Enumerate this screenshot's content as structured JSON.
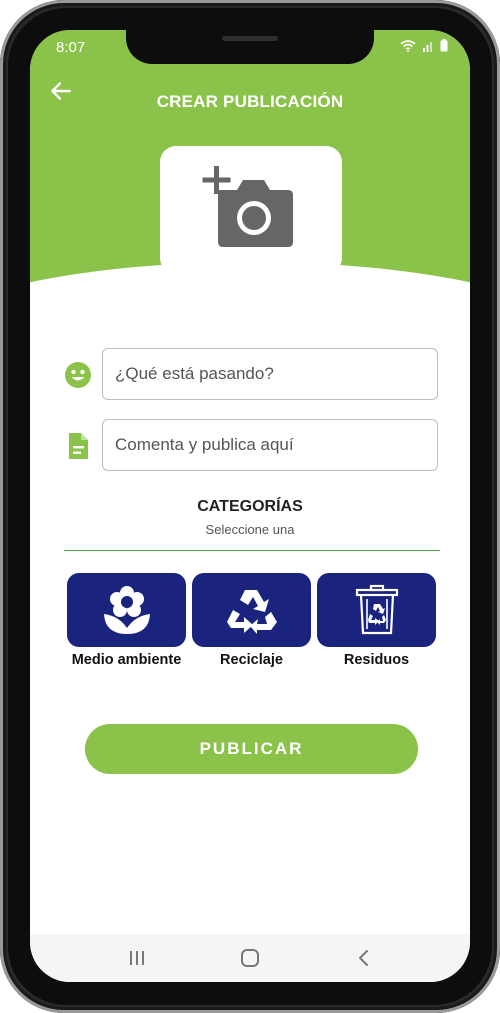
{
  "status_bar": {
    "time": "8:07",
    "wifi_icon": "wifi-icon",
    "signal_icon": "signal-icon",
    "battery_icon": "battery-icon"
  },
  "header": {
    "title": "CREAR PUBLICACIÓN",
    "back_icon": "arrow-left-icon",
    "photo_icon": "add-photo-icon"
  },
  "colors": {
    "primary_green": "#8bc34a",
    "category_blue": "#1a237e",
    "divider_green": "#43a047"
  },
  "form": {
    "title_field": {
      "placeholder": "¿Qué está pasando?",
      "value": "",
      "icon": "smiley-icon"
    },
    "comment_field": {
      "placeholder": "Comenta y publica aquí",
      "value": "",
      "icon": "document-icon"
    }
  },
  "categories": {
    "title": "CATEGORÍAS",
    "subtitle": "Seleccione una",
    "items": [
      {
        "label": "Medio ambiente",
        "icon": "flower-icon"
      },
      {
        "label": "Reciclaje",
        "icon": "recycle-icon"
      },
      {
        "label": "Residuos",
        "icon": "recycle-bin-icon"
      }
    ]
  },
  "publish_button": {
    "label": "PUBLICAR"
  },
  "nav_bar": {
    "recents_icon": "recents-icon",
    "home_icon": "home-icon",
    "back_icon": "back-chevron-icon"
  }
}
